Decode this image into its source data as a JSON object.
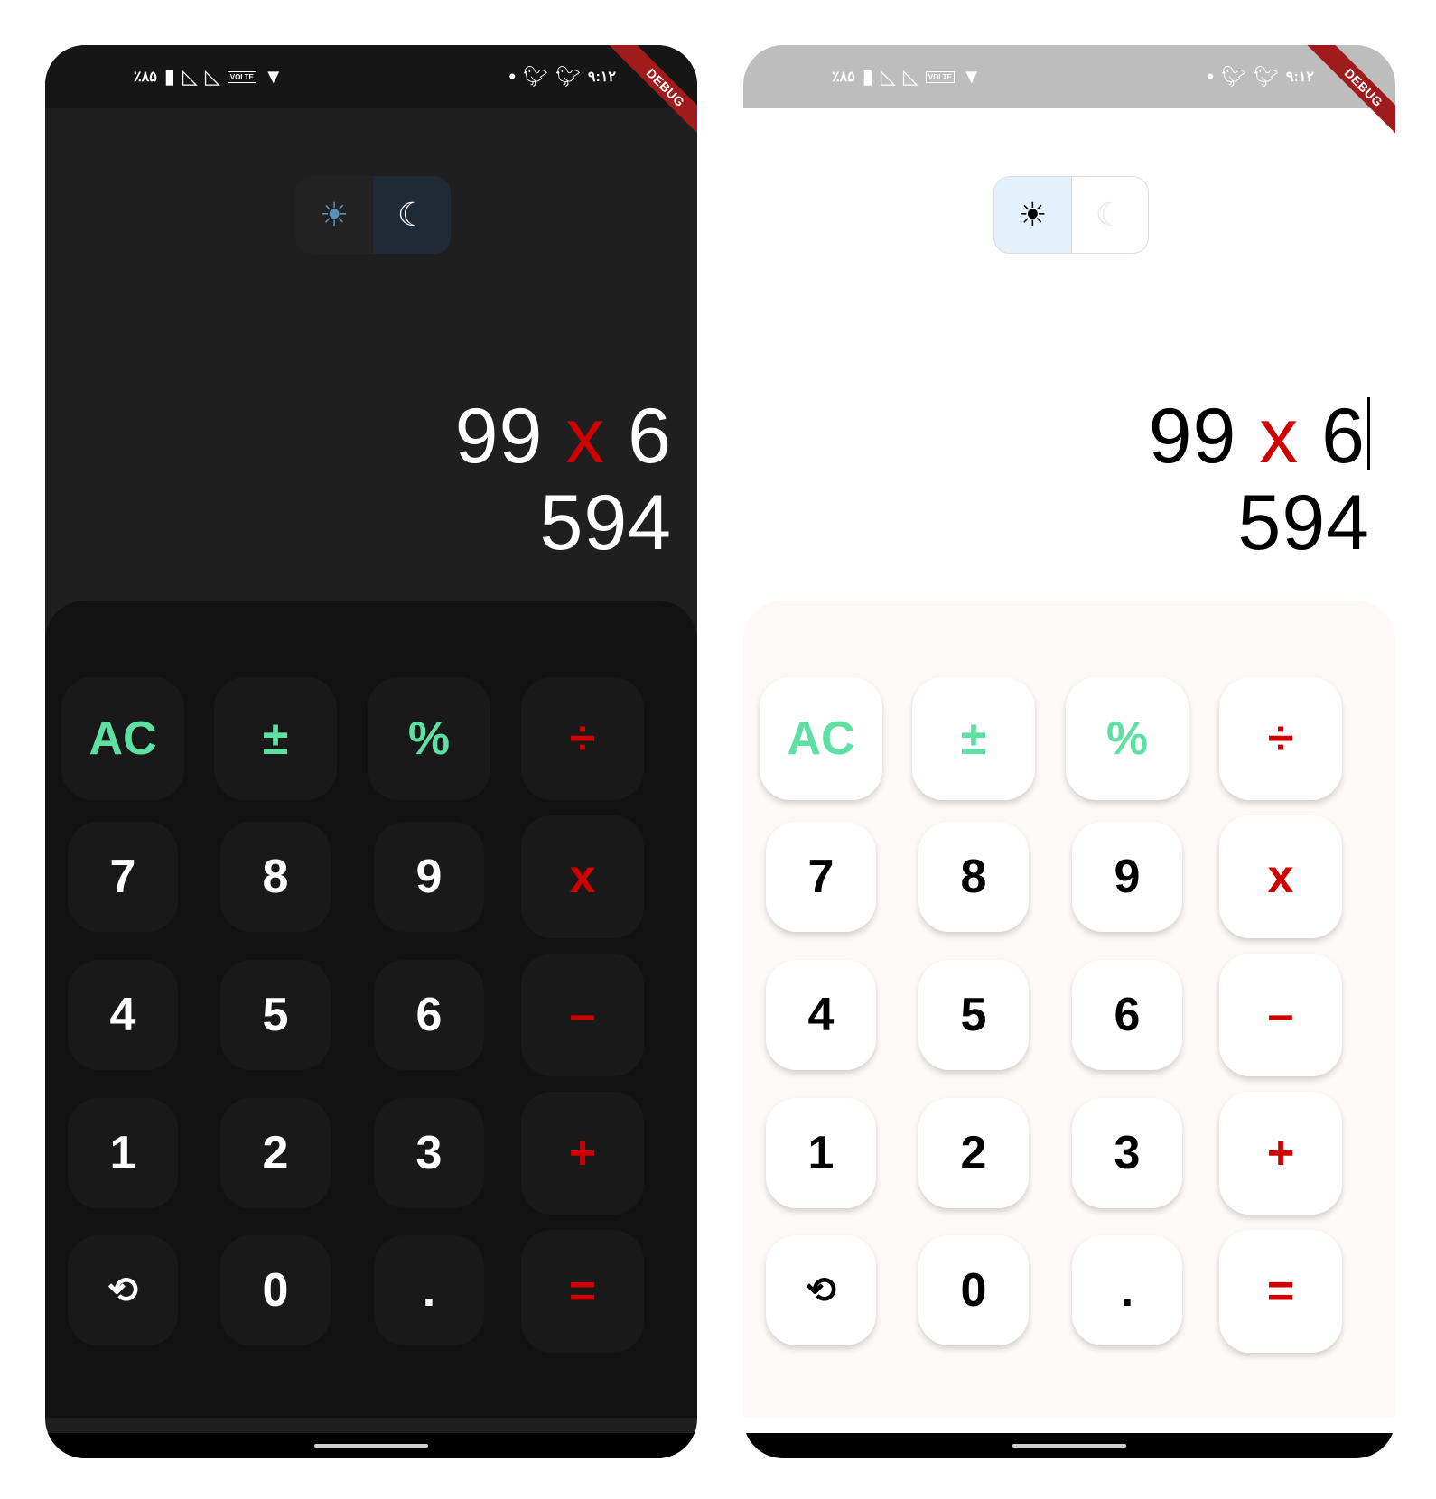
{
  "statusbar": {
    "battery_percent": "٪۸۵",
    "clock": "۹:۱۲",
    "volte_label": "VOLTE",
    "debug_banner": "DEBUG"
  },
  "theme_toggle": {
    "light_icon": "sun-icon",
    "dark_icon": "moon-icon",
    "sun_glyph": "☀",
    "moon_glyph": "☾"
  },
  "dark_theme": {
    "active_mode": "dark",
    "expression": {
      "left": "99",
      "operator": "x",
      "right": "6"
    },
    "result": "594"
  },
  "light_theme": {
    "active_mode": "light",
    "expression": {
      "left": "99",
      "operator": "x",
      "right": "6"
    },
    "result": "594"
  },
  "keys": {
    "clear": "AC",
    "plus_minus": "±",
    "percent": "%",
    "divide": "÷",
    "seven": "7",
    "eight": "8",
    "nine": "9",
    "multiply": "x",
    "four": "4",
    "five": "5",
    "six": "6",
    "minus": "–",
    "one": "1",
    "two": "2",
    "three": "3",
    "plus": "+",
    "history_glyph": "⟲",
    "zero": "0",
    "decimal": ".",
    "equals": "="
  },
  "colors": {
    "function_key": "#5fe0a3",
    "operator": "#d00000",
    "dark_background": "#1f1f1f",
    "dark_keypad": "#121212",
    "light_keypad": "#fdf9f8"
  }
}
